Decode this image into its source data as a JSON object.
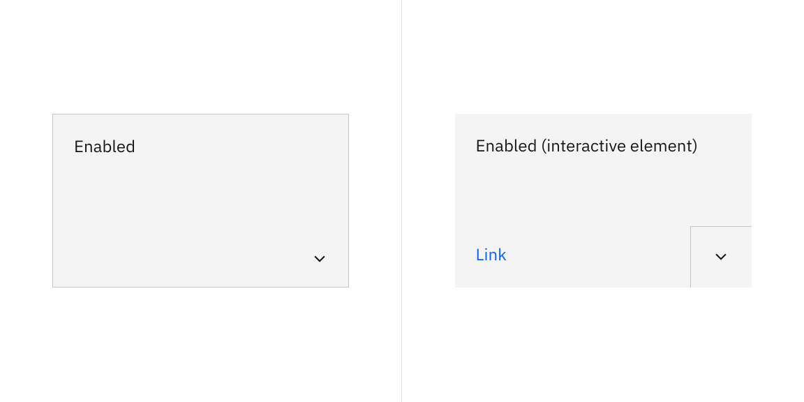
{
  "left": {
    "title": "Enabled"
  },
  "right": {
    "title": "Enabled (interactive element)",
    "link": "Link"
  }
}
